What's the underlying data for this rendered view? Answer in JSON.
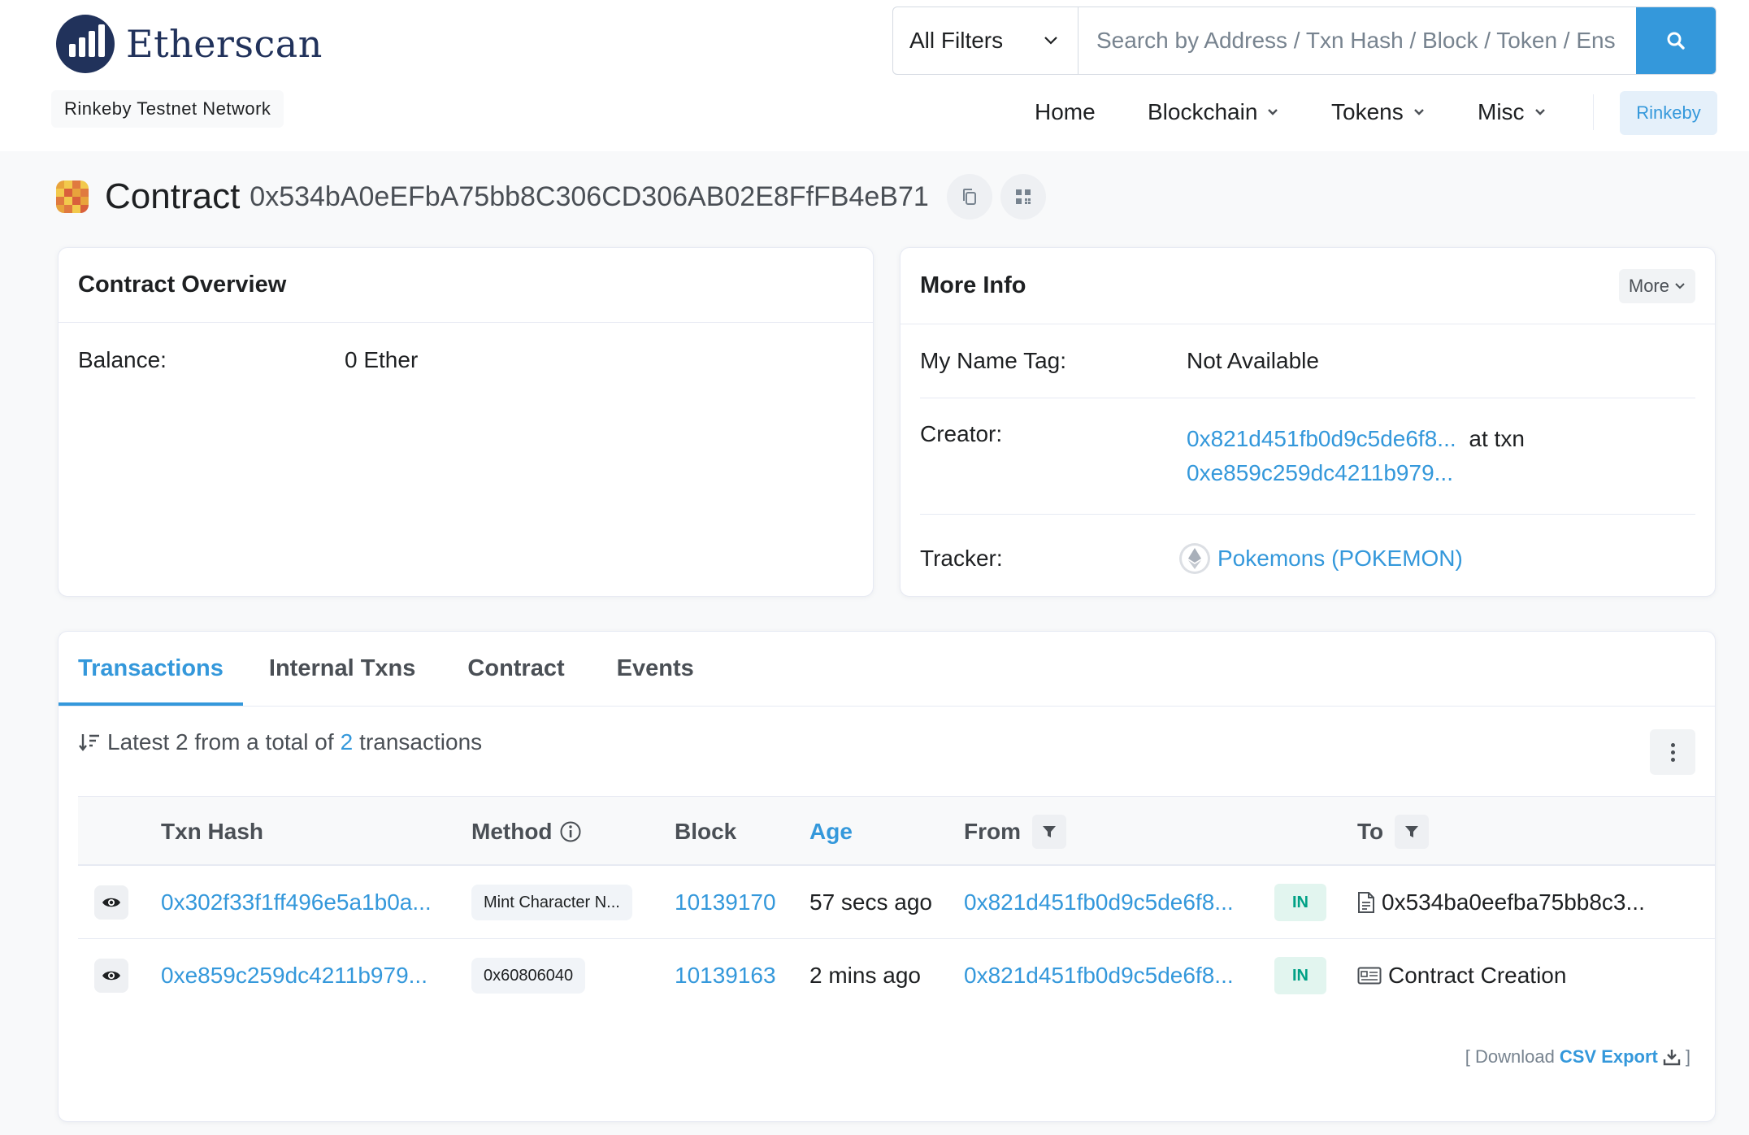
{
  "brand": {
    "name": "Etherscan",
    "network_badge": "Rinkeby Testnet Network"
  },
  "search": {
    "filter_label": "All Filters",
    "placeholder": "Search by Address / Txn Hash / Block / Token / Ens"
  },
  "nav": {
    "home": "Home",
    "blockchain": "Blockchain",
    "tokens": "Tokens",
    "misc": "Misc",
    "network": "Rinkeby"
  },
  "page": {
    "title": "Contract",
    "address": "0x534bA0eEFbA75bb8C306CD306AB02E8FfFB4eB71"
  },
  "overview": {
    "header": "Contract Overview",
    "balance_label": "Balance:",
    "balance_value": "0 Ether"
  },
  "more_info": {
    "header": "More Info",
    "more_button": "More",
    "name_tag_label": "My Name Tag:",
    "name_tag_value": "Not Available",
    "creator_label": "Creator:",
    "creator_address": "0x821d451fb0d9c5de6f8...",
    "creator_at_txn": "at txn",
    "creator_txn": "0xe859c259dc4211b979...",
    "tracker_label": "Tracker:",
    "tracker_value": "Pokemons (POKEMON)"
  },
  "tabs": [
    "Transactions",
    "Internal Txns",
    "Contract",
    "Events"
  ],
  "summary": {
    "prefix": "Latest 2 from a total of",
    "count": "2",
    "suffix": "transactions"
  },
  "table": {
    "headers": {
      "txn_hash": "Txn Hash",
      "method": "Method",
      "block": "Block",
      "age": "Age",
      "from": "From",
      "to": "To"
    },
    "rows": [
      {
        "hash": "0x302f33f1ff496e5a1b0a...",
        "method": "Mint Character N...",
        "block": "10139170",
        "age": "57 secs ago",
        "from": "0x821d451fb0d9c5de6f8...",
        "direction": "IN",
        "to": "0x534ba0eefba75bb8c3..."
      },
      {
        "hash": "0xe859c259dc4211b979...",
        "method": "0x60806040",
        "block": "10139163",
        "age": "2 mins ago",
        "from": "0x821d451fb0d9c5de6f8...",
        "direction": "IN",
        "to": "Contract Creation"
      }
    ]
  },
  "csv": {
    "open": "[ Download",
    "label": "CSV Export",
    "close": "]"
  },
  "colors": {
    "accent": "#3498db",
    "brand_navy": "#21325b",
    "in_green": "#00a186"
  }
}
